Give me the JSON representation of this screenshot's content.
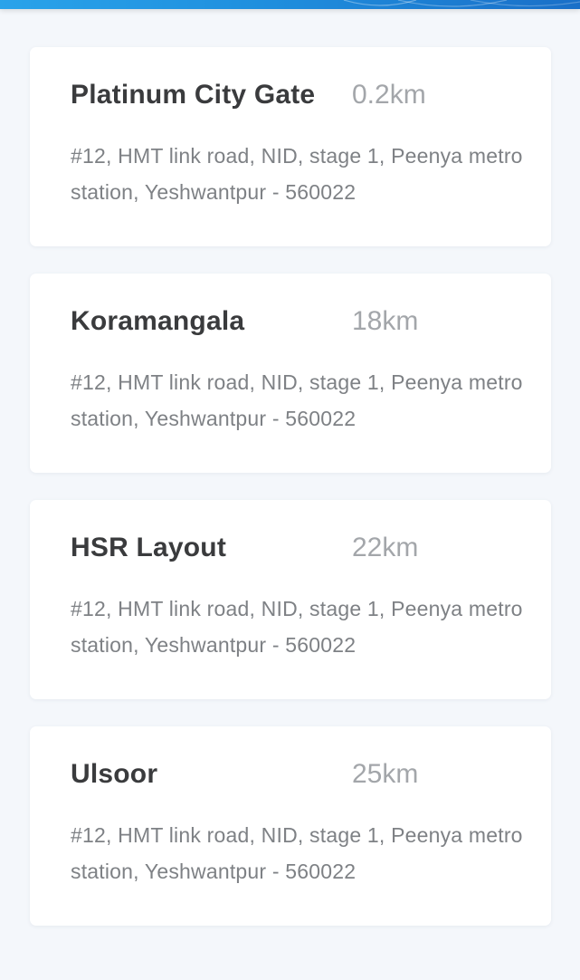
{
  "colors": {
    "header_blue": "#1f8fde",
    "background": "#f4f7fb",
    "card": "#ffffff",
    "title_text": "#3a3b3d",
    "distance_text": "#a3a6aa",
    "address_text": "#7e8185"
  },
  "locations": [
    {
      "name": "Platinum City Gate",
      "distance": "0.2km",
      "address": "#12, HMT link road, NID, stage 1, Peenya metro station, Yeshwantpur - 560022"
    },
    {
      "name": "Koramangala",
      "distance": "18km",
      "address": "#12, HMT link road, NID, stage 1, Peenya metro station, Yeshwantpur - 560022"
    },
    {
      "name": "HSR Layout",
      "distance": "22km",
      "address": "#12, HMT link road, NID, stage 1, Peenya metro station, Yeshwantpur - 560022"
    },
    {
      "name": "Ulsoor",
      "distance": "25km",
      "address": "#12, HMT link road, NID, stage 1, Peenya metro station, Yeshwantpur - 560022"
    }
  ]
}
